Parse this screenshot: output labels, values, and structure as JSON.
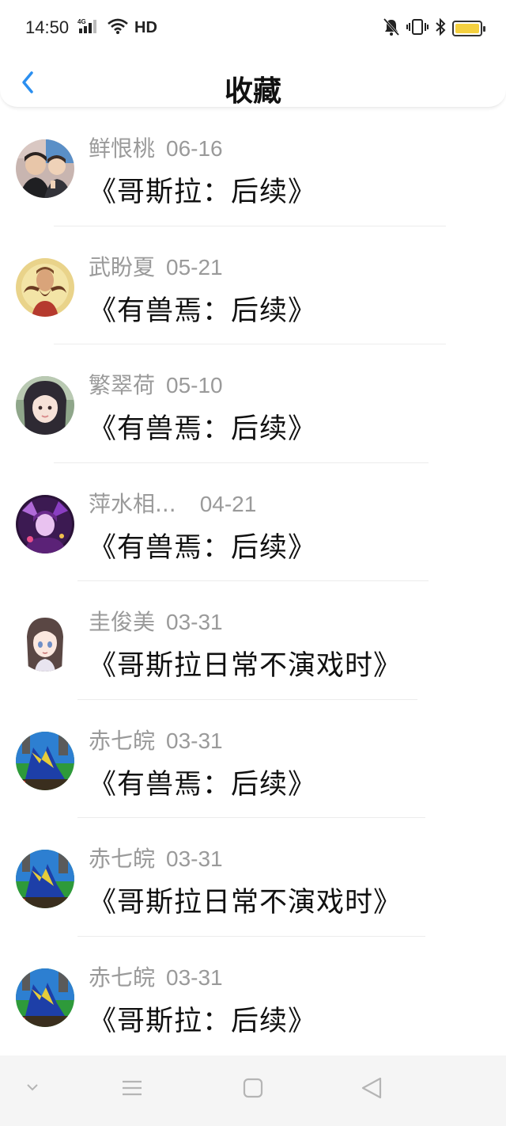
{
  "status": {
    "time": "14:50",
    "network": "4G",
    "hd": "HD",
    "battery_color": "#f4d03f"
  },
  "header": {
    "title": "收藏",
    "back_icon": "chevron-left-icon",
    "accent_color": "#2b8ff0"
  },
  "items": [
    {
      "author": "鲜恨桃",
      "date": "06-16",
      "title": "《哥斯拉：后续》",
      "avatar": "photo-two-boys"
    },
    {
      "author": "武盼夏",
      "date": "05-21",
      "title": "《有兽焉：后续》",
      "avatar": "bearded-man-illustration"
    },
    {
      "author": "繁翠荷",
      "date": "05-10",
      "title": "《有兽焉：后续》",
      "avatar": "girl-portrait"
    },
    {
      "author": "萍水相...",
      "date": "04-21",
      "title": "《有兽焉：后续》",
      "avatar": "purple-anime-character"
    },
    {
      "author": "圭俊美",
      "date": "03-31",
      "title": "《哥斯拉日常不演戏时》",
      "avatar": "anime-girl"
    },
    {
      "author": "赤七皖",
      "date": "03-31",
      "title": "《有兽焉：后续》",
      "avatar": "pixel-godzilla"
    },
    {
      "author": "赤七皖",
      "date": "03-31",
      "title": "《哥斯拉日常不演戏时》",
      "avatar": "pixel-godzilla"
    },
    {
      "author": "赤七皖",
      "date": "03-31",
      "title": "《哥斯拉：后续》",
      "avatar": "pixel-godzilla"
    }
  ],
  "bottom_nav": {
    "icons": [
      "collapse-chevron-icon",
      "menu-icon",
      "home-square-icon",
      "back-triangle-icon"
    ]
  }
}
